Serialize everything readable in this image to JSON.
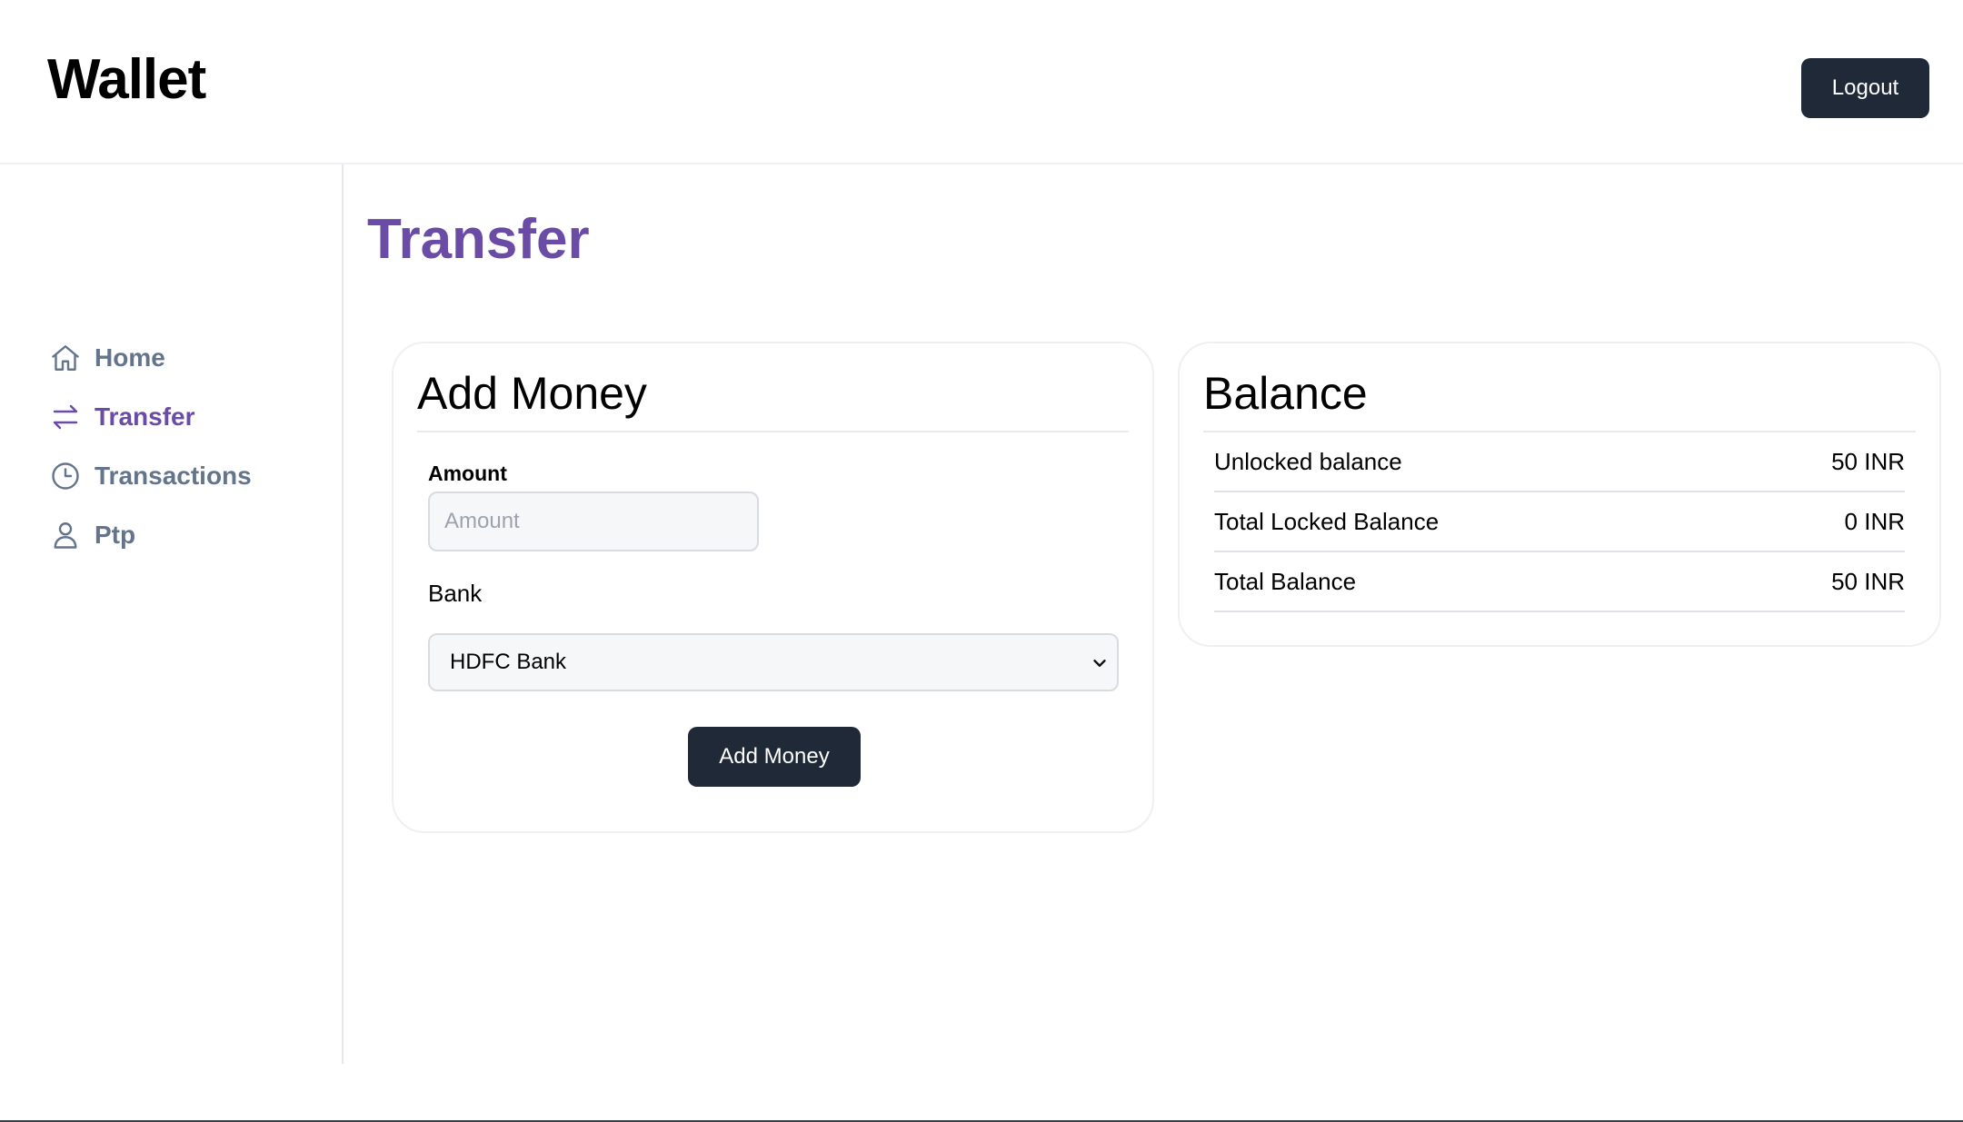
{
  "header": {
    "brand": "Wallet",
    "logout_label": "Logout"
  },
  "sidebar": {
    "items": [
      {
        "label": "Home",
        "icon": "home-icon",
        "active": false
      },
      {
        "label": "Transfer",
        "icon": "arrows-swap-icon",
        "active": true
      },
      {
        "label": "Transactions",
        "icon": "clock-icon",
        "active": false
      },
      {
        "label": "Ptp",
        "icon": "user-icon",
        "active": false
      }
    ]
  },
  "page": {
    "title": "Transfer"
  },
  "add_money": {
    "title": "Add Money",
    "amount_label": "Amount",
    "amount_placeholder": "Amount",
    "amount_value": "",
    "bank_label": "Bank",
    "bank_selected": "HDFC Bank",
    "submit_label": "Add Money"
  },
  "balance": {
    "title": "Balance",
    "rows": [
      {
        "label": "Unlocked balance",
        "value": "50 INR"
      },
      {
        "label": "Total Locked Balance",
        "value": "0 INR"
      },
      {
        "label": "Total Balance",
        "value": "50 INR"
      }
    ]
  },
  "colors": {
    "accent": "#6a4ba5",
    "muted": "#64748b",
    "button_bg": "#1f2937"
  }
}
